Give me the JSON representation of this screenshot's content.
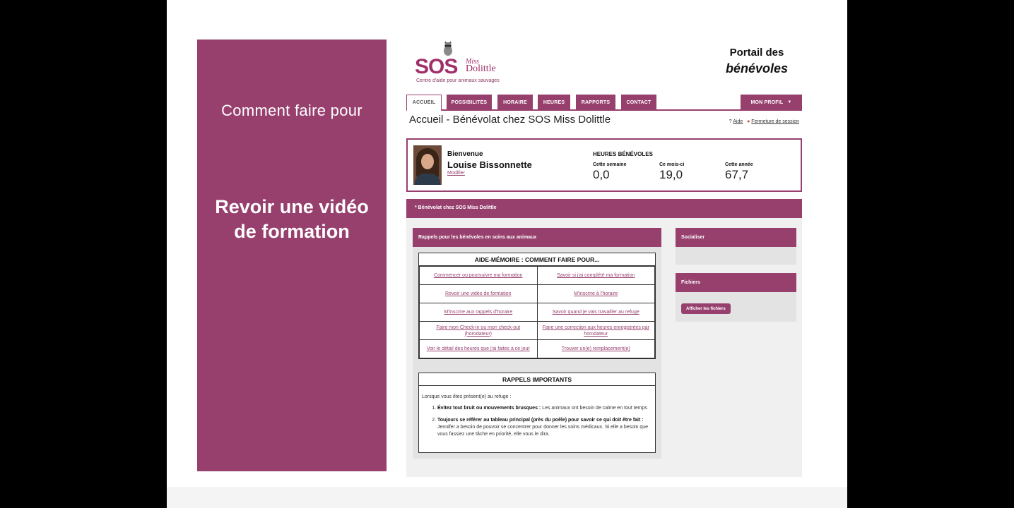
{
  "side_panel": {
    "intro": "Comment faire pour",
    "topic": "Revoir une vidéo de formation"
  },
  "logo": {
    "sos": "SOS",
    "miss": "Miss",
    "dolittle": "Dolittle",
    "tagline": "Centre d'aide pour animaux sauvages"
  },
  "portal_title": {
    "line1": "Portail des",
    "line2": "bénévoles"
  },
  "nav": {
    "tabs": [
      "ACCUEIL",
      "POSSIBILITÉS",
      "HORAIRE",
      "HEURES",
      "RAPPORTS",
      "CONTACT"
    ],
    "profile": "MON PROFIL"
  },
  "page": {
    "heading": "Accueil - Bénévolat chez SOS Miss Dolittle",
    "help": "Aide",
    "logout": "Fermeture de session"
  },
  "welcome": {
    "greeting": "Bienvenue",
    "name": "Louise Bissonnette",
    "edit": "Modifier",
    "hours_title": "HEURES BÉNÉVOLES",
    "stats": [
      {
        "label": "Cette semaine",
        "value": "0,0"
      },
      {
        "label": "Ce mois-ci",
        "value": "19,0"
      },
      {
        "label": "Cette année",
        "value": "67,7"
      }
    ]
  },
  "band": "* Bénévolat chez SOS Miss Dolittle",
  "reminders": {
    "header": "Rappels pour les bénévoles en soins aux animaux",
    "memo_title": "AIDE-MÉMOIRE : COMMENT FAIRE POUR...",
    "links": [
      [
        "Commencer ou poursuivre ma formation",
        "Savoir si j'ai complété ma formation"
      ],
      [
        "Revoir une vidéo de formation",
        "M'inscrire à l'horaire"
      ],
      [
        "M'inscrire aux rappels d'horaire",
        "Savoir quand je vais travailler au refuge"
      ],
      [
        "Faire mon Check-in ou mon check-out (horodateur)",
        "Faire une correction aux heures enregistrées par horodateur"
      ],
      [
        "Voir le détail des heures que j'ai faites à ce jour",
        "Trouver un(e) remplacement(e)"
      ]
    ],
    "important_title": "RAPPELS IMPORTANTS",
    "important_intro": "Lorsque vous êtes présent(e) au refuge :",
    "important_items": [
      {
        "bold": "Évitez tout bruit ou mouvements brusques :",
        "text": " Les animaux ont besoin de calme en tout temps"
      },
      {
        "bold": "Toujours se référer au tableau principal (près du poêle) pour savoir ce qui doit être fait :",
        "text": " Jennifer a besoin de pouvoir se concentrer pour donner les soins médicaux. Si elle a besoin que vous fassiez une tâche en priorité, elle vous le dira."
      }
    ]
  },
  "socialiser": {
    "header": "Socialiser"
  },
  "fichiers": {
    "header": "Fichiers",
    "button": "Afficher les fichiers"
  },
  "colors": {
    "accent": "#97406e"
  }
}
